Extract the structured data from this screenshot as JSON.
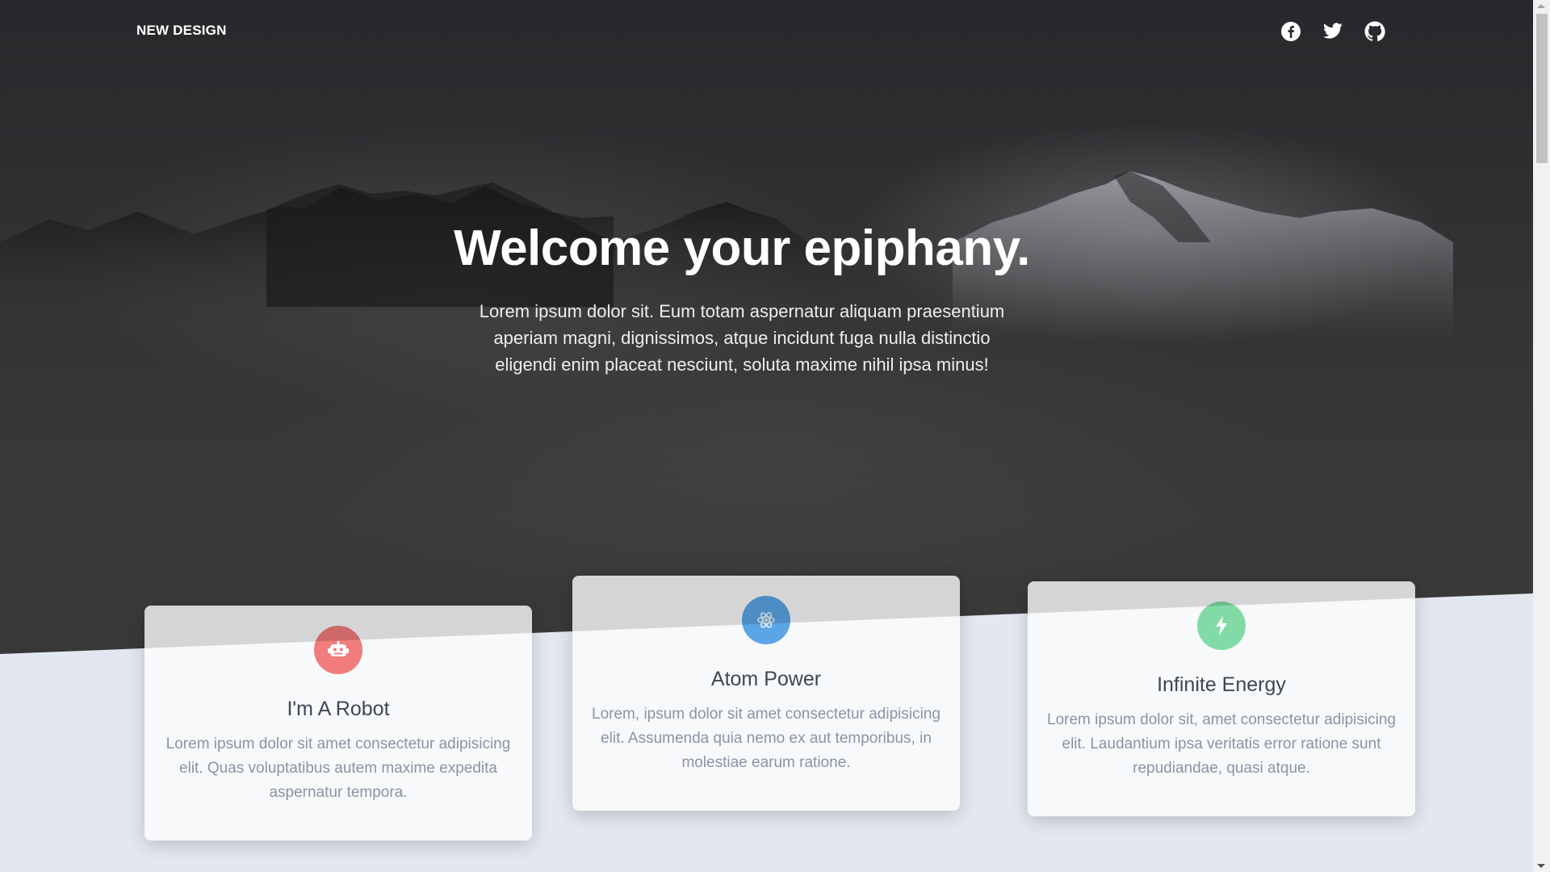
{
  "nav": {
    "logo": "NEW DESIGN",
    "social": [
      {
        "icon": "facebook-icon"
      },
      {
        "icon": "twitter-icon"
      },
      {
        "icon": "github-icon"
      }
    ]
  },
  "hero": {
    "title": "Welcome your epiphany.",
    "subtitle": "Lorem ipsum dolor sit. Eum totam aspernatur aliquam praesentium aperiam magni, dignissimos, atque incidunt fuga nulla distinctio eligendi enim placeat nesciunt, soluta maxime nihil ipsa minus!"
  },
  "features": [
    {
      "icon": "robot-icon",
      "color": "#f07c7c",
      "title": "I'm A Robot",
      "text": "Lorem ipsum dolor sit amet consectetur adipisicing elit. Quas voluptatibus autem maxime expedita aspernatur tempora."
    },
    {
      "icon": "atom-icon",
      "color": "#5ba4e5",
      "title": "Atom Power",
      "text": "Lorem, ipsum dolor sit amet consectetur adipisicing elit. Assumenda quia nemo ex aut temporibus, in molestiae earum ratione."
    },
    {
      "icon": "bolt-icon",
      "color": "#82dba6",
      "title": "Infinite Energy",
      "text": "Lorem ipsum dolor sit, amet consectetur adipisicing elit. Laudantium ipsa veritatis error ratione sunt repudiandae, quasi atque."
    }
  ],
  "colors": {
    "hero_dark": "#333335",
    "section_bg": "#e3e8f0",
    "card_bg": "#f8f9fb",
    "heading_text": "#3f4753",
    "body_text": "#8a94a3"
  }
}
